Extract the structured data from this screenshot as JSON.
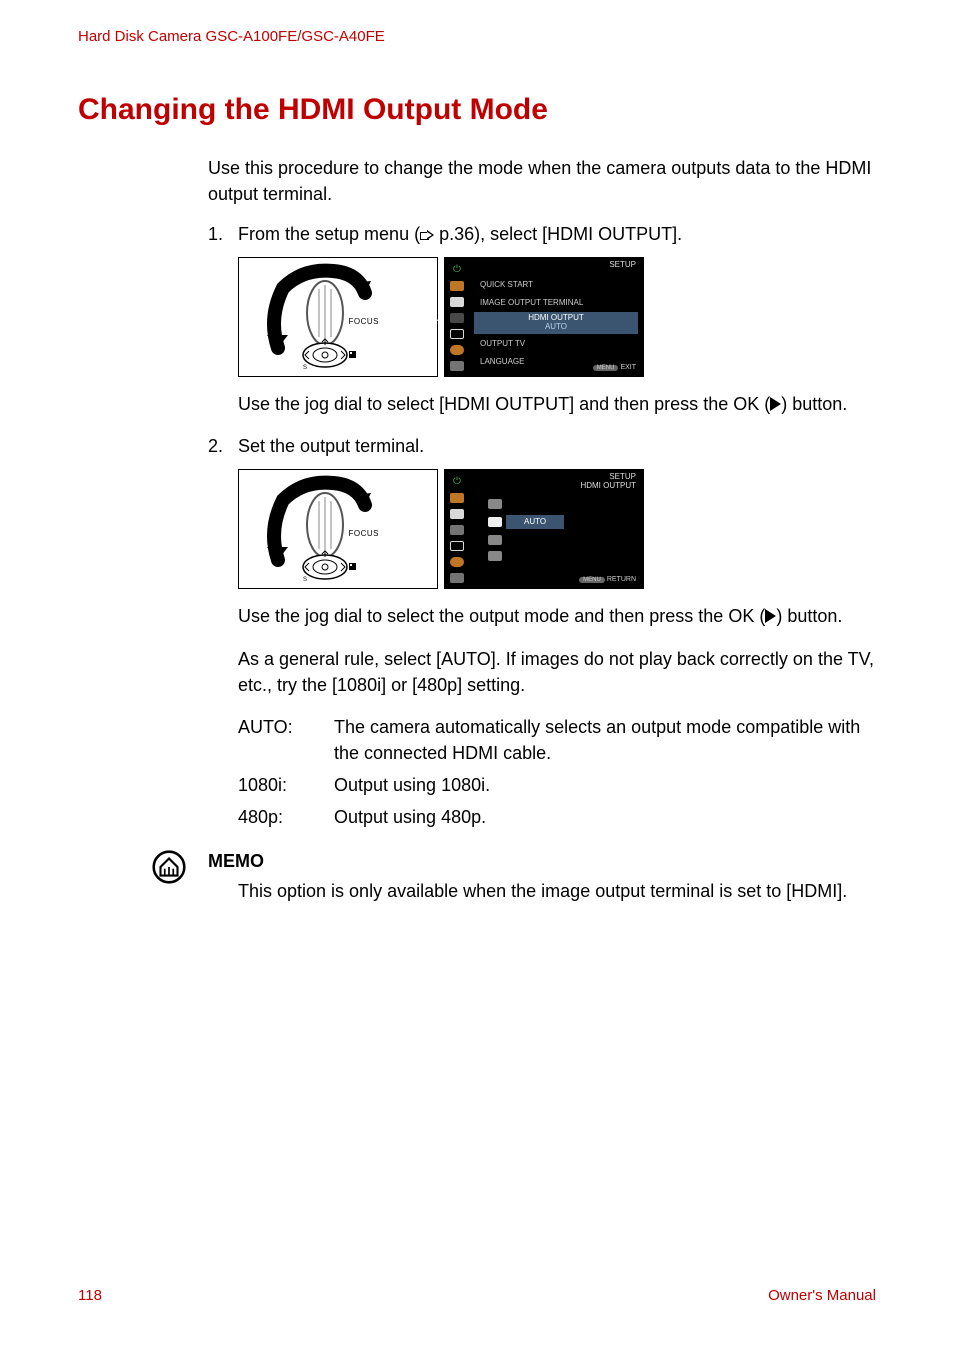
{
  "header": {
    "title": "Hard Disk Camera GSC-A100FE/GSC-A40FE"
  },
  "heading": "Changing the HDMI Output Mode",
  "intro": "Use this procedure to change the mode when the camera outputs data to the HDMI output terminal.",
  "step1": {
    "num": "1.",
    "text_a": "From the setup menu (",
    "text_b": " p.36), select [HDMI OUTPUT].",
    "dial_label": "FOCUS",
    "screen": {
      "header": "SETUP",
      "items": [
        "QUICK START",
        "IMAGE OUTPUT TERMINAL"
      ],
      "highlight_top": "HDMI OUTPUT",
      "highlight_bottom": "AUTO",
      "after": [
        "OUTPUT TV",
        "LANGUAGE"
      ],
      "footer_pill": "MENU",
      "footer_text": "EXIT"
    },
    "after_a": "Use the jog dial to select [HDMI OUTPUT] and then press the OK (",
    "after_b": ") button."
  },
  "step2": {
    "num": "2.",
    "text": "Set the output terminal.",
    "dial_label": "FOCUS",
    "screen": {
      "header_top": "SETUP",
      "header_bottom": "HDMI OUTPUT",
      "selected": "AUTO",
      "footer_pill": "MENU",
      "footer_text": "RETURN"
    },
    "after_a": "Use the jog dial to select the output mode and then press the OK (",
    "after_b": ") button.",
    "rule": "As a general rule, select [AUTO]. If images do not play back correctly on the TV, etc., try the [1080i] or [480p] setting.",
    "defs": [
      {
        "term": "AUTO:",
        "desc": "The camera automatically selects an output mode compatible with the connected HDMI cable."
      },
      {
        "term": "1080i:",
        "desc": "Output using 1080i."
      },
      {
        "term": "480p:",
        "desc": "Output using 480p."
      }
    ]
  },
  "memo": {
    "title": "MEMO",
    "text": "This option is only available when the image output terminal is set to [HDMI]."
  },
  "footer": {
    "page": "118",
    "label": "Owner's Manual"
  }
}
